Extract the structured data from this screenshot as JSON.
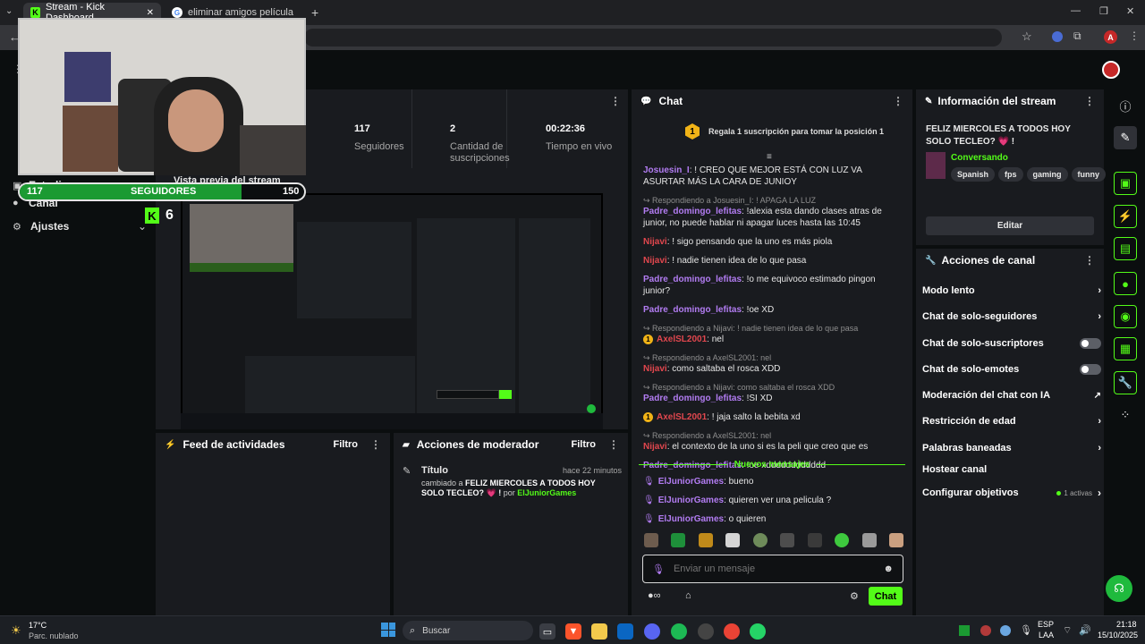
{
  "browser": {
    "tabs": [
      {
        "label": "Stream - Kick Dashboard"
      },
      {
        "label": "eliminar amigos película - Busc"
      }
    ],
    "new_tab": "+",
    "win_controls": {
      "min": "—",
      "max": "❐",
      "close": "✕"
    },
    "profile_initial": "A"
  },
  "sidebar": {
    "items": [
      {
        "label": "Estudio"
      },
      {
        "label": "Canal"
      },
      {
        "label": "Ajustes"
      }
    ]
  },
  "overlay": {
    "followers_current": "117",
    "followers_label": "SEGUIDORES",
    "followers_goal": "150",
    "followers_progress": 0.78,
    "kick_count": "6"
  },
  "stats": [
    {
      "value": "117",
      "label": "Seguidores"
    },
    {
      "value": "2",
      "label": "Cantidad de suscripciones"
    },
    {
      "value": "00:22:36",
      "label": "Tiempo en vivo"
    }
  ],
  "preview": {
    "title": "Vista previa del stream"
  },
  "activity_feed": {
    "title": "Feed de actividades",
    "filter": "Filtro"
  },
  "mod_actions": {
    "title": "Acciones de moderador",
    "filter": "Filtro",
    "entry": {
      "heading": "Título",
      "time": "hace 22 minutos",
      "prefix": "cambiado a",
      "value": "FELIZ MIERCOLES A TODOS HOY SOLO TECLEO? 💗 !",
      "by": "por",
      "user": "ElJuniorGames"
    }
  },
  "chat": {
    "title": "Chat",
    "pinned_rank": "1",
    "pinned_text": "Regala 1 suscripción para tomar la posición 1",
    "messages": [
      {
        "user": "Josuesin_I",
        "color": "purple",
        "text": ": ! CREO QUE MEJOR ESTÁ CON LUZ VA ASURTAR MÁS LA CARA DE JUNIOY"
      },
      {
        "reply": "Respondiendo a Josuesin_I: ! APAGA LA LUZ",
        "user": "Padre_domingo_lefitas",
        "color": "purple",
        "text": ": !alexia esta dando clases atras de junior, no puede hablar ni apagar luces hasta las 10:45"
      },
      {
        "user": "Nijavi",
        "color": "red",
        "text": ": ! sigo pensando que la uno es más piola"
      },
      {
        "user": "Nijavi",
        "color": "red",
        "text": ": ! nadie tienen idea de lo que pasa"
      },
      {
        "user": "Padre_domingo_lefitas",
        "color": "purple",
        "text": ": !o me equivoco estimado pingon junior?"
      },
      {
        "user": "Padre_domingo_lefitas",
        "color": "purple",
        "text": ": !oe XD"
      },
      {
        "reply": "Respondiendo a Nijavi: ! nadie tienen idea de lo que pasa",
        "badge": "1",
        "user": "AxelSL2001",
        "color": "red",
        "text": ": nel"
      },
      {
        "reply": "Respondiendo a AxelSL2001: nel",
        "user": "Nijavi",
        "color": "red",
        "text": ": como saltaba el rosca XDD"
      },
      {
        "reply": "Respondiendo a Nijavi: como saltaba el rosca XDD",
        "user": "Padre_domingo_lefitas",
        "color": "purple",
        "text": ": !SI XD"
      },
      {
        "badge": "1",
        "user": "AxelSL2001",
        "color": "red",
        "text": ": ! jaja salto la bebita xd"
      },
      {
        "reply": "Respondiendo a AxelSL2001: nel",
        "user": "Nijavi",
        "color": "red",
        "text": ": el contexto de la uno si es la peli que creo que es"
      },
      {
        "user": "Padre_domingo_lefitas",
        "color": "purple",
        "text": ": !oe xdddddddddddd"
      }
    ],
    "new_messages_label": "Nuevos mensajes",
    "new_messages": [
      {
        "user": "ElJuniorGames",
        "text": ": bueno"
      },
      {
        "user": "ElJuniorGames",
        "text": ": quieren ver una pelicula ?"
      },
      {
        "user": "ElJuniorGames",
        "text": ": o quieren"
      }
    ],
    "input_placeholder": "Enviar un mensaje",
    "send_label": "Chat"
  },
  "stream_info": {
    "title": "Información del stream",
    "stream_title": "FELIZ MIERCOLES A TODOS HOY SOLO TECLEO? 💗 !",
    "category": "Conversando",
    "tags": [
      "Spanish",
      "fps",
      "gaming",
      "funny"
    ],
    "edit_label": "Editar"
  },
  "channel_actions": {
    "title": "Acciones de canal",
    "items": [
      {
        "label": "Modo lento"
      },
      {
        "label": "Chat de solo-seguidores"
      },
      {
        "label": "Chat de solo-suscriptores"
      },
      {
        "label": "Chat de solo-emotes"
      },
      {
        "label": "Moderación del chat con IA"
      },
      {
        "label": "Restricción de edad"
      },
      {
        "label": "Palabras baneadas"
      },
      {
        "label": "Hostear canal"
      },
      {
        "label": "Configurar objetivos"
      }
    ],
    "goals_status": "1 activas"
  },
  "taskbar": {
    "weather_temp": "17°C",
    "weather_desc": "Parc. nublado",
    "search_placeholder": "Buscar",
    "lang": "ESP",
    "lang_sub": "LAA",
    "time": "21:18",
    "date": "15/10/2025"
  },
  "colors": {
    "accent": "#53fc18",
    "panel": "#191b1f",
    "bg": "#0b0e0f"
  }
}
